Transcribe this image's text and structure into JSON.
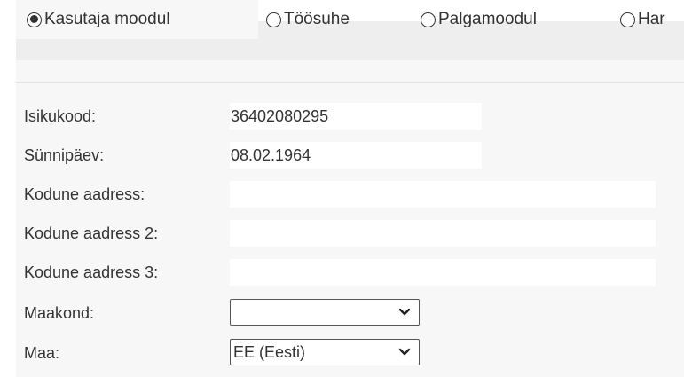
{
  "tabs": [
    {
      "label": "Kasutaja moodul",
      "selected": true
    },
    {
      "label": "Töösuhe",
      "selected": false
    },
    {
      "label": "Palgamoodul",
      "selected": false
    },
    {
      "label": "Har",
      "selected": false
    }
  ],
  "form": {
    "isikukood": {
      "label": "Isikukood:",
      "value": "36402080295"
    },
    "sunnipaev": {
      "label": "Sünnipäev:",
      "value": "08.02.1964"
    },
    "aadress1": {
      "label": "Kodune aadress:",
      "value": ""
    },
    "aadress2": {
      "label": "Kodune aadress 2:",
      "value": ""
    },
    "aadress3": {
      "label": "Kodune aadress 3:",
      "value": ""
    },
    "maakond": {
      "label": "Maakond:",
      "value": ""
    },
    "maa": {
      "label": "Maa:",
      "value": "EE (Eesti)"
    }
  },
  "colors": {
    "tabbar": "#eeeeee",
    "panel": "#f7f7f7",
    "text": "#333333"
  },
  "icons": {
    "radio": "radio-button-icon",
    "dropdown": "chevron-down-icon"
  }
}
